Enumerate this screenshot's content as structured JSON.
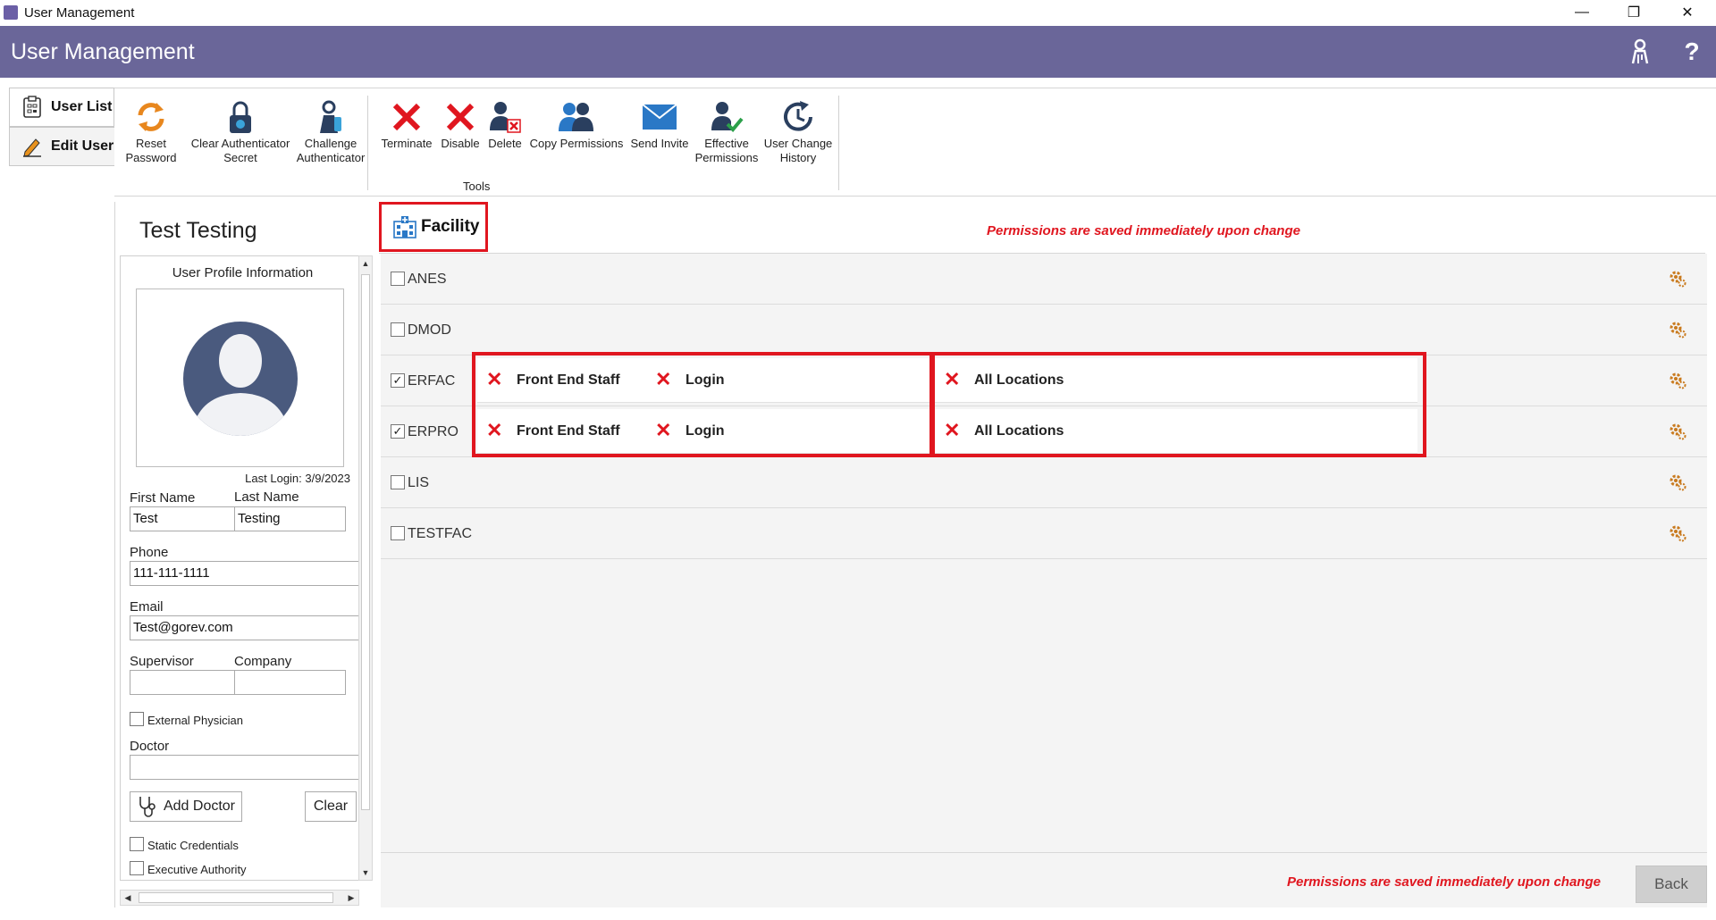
{
  "window": {
    "title": "User Management",
    "controls": [
      "—",
      "❐",
      "✕"
    ]
  },
  "header": {
    "title": "User Management",
    "key_icon": "key-person-icon",
    "help_label": "?"
  },
  "side_tabs": [
    {
      "label": "User List",
      "icon": "clipboard-icon"
    },
    {
      "label": "Edit User",
      "icon": "pencil-icon"
    }
  ],
  "ribbon": {
    "buttons": [
      {
        "label": "Reset\nPassword",
        "icon": "reset-icon"
      },
      {
        "label": "Clear Authenticator\nSecret",
        "icon": "lock-icon"
      },
      {
        "label": "Challenge\nAuthenticator",
        "icon": "key-person-icon"
      },
      {
        "label": "Terminate",
        "icon": "red-x-icon"
      },
      {
        "label": "Disable",
        "icon": "red-x-icon"
      },
      {
        "label": "Delete",
        "icon": "user-delete-icon"
      },
      {
        "label": "Copy Permissions",
        "icon": "users-icon"
      },
      {
        "label": "Send Invite",
        "icon": "envelope-icon"
      },
      {
        "label": "Effective\nPermissions",
        "icon": "user-check-icon"
      },
      {
        "label": "User Change\nHistory",
        "icon": "history-icon"
      }
    ],
    "group_label": "Tools"
  },
  "user": {
    "display_name": "Test Testing",
    "profile_header": "User Profile Information",
    "last_login": "Last Login: 3/9/2023",
    "first_name_label": "First Name",
    "first_name": "Test",
    "last_name_label": "Last Name",
    "last_name": "Testing",
    "phone_label": "Phone",
    "phone": "111-111-1111",
    "email_label": "Email",
    "email": "Test@gorev.com",
    "supervisor_label": "Supervisor",
    "supervisor": "",
    "company_label": "Company",
    "company": "",
    "external_physician_label": "External Physician",
    "doctor_label": "Doctor",
    "doctor": "",
    "add_doctor_label": "Add Doctor",
    "clear_label": "Clear",
    "static_credentials_label": "Static Credentials",
    "executive_authority_label": "Executive Authority"
  },
  "facility": {
    "tab_label": "Facility",
    "save_note": "Permissions are saved immediately upon change",
    "rows": [
      {
        "name": "ANES",
        "checked": false,
        "roles": [],
        "locations": []
      },
      {
        "name": "DMOD",
        "checked": false,
        "roles": [],
        "locations": []
      },
      {
        "name": "ERFAC",
        "checked": true,
        "roles": [
          "Front End Staff",
          "Login"
        ],
        "locations": [
          "All Locations"
        ]
      },
      {
        "name": "ERPRO",
        "checked": true,
        "roles": [
          "Front End Staff",
          "Login"
        ],
        "locations": [
          "All Locations"
        ]
      },
      {
        "name": "LIS",
        "checked": false,
        "roles": [],
        "locations": []
      },
      {
        "name": "TESTFAC",
        "checked": false,
        "roles": [],
        "locations": []
      }
    ],
    "check_mark": "✓",
    "remove_mark": "✕",
    "colors": {
      "accent": "#e0161f",
      "header": "#6a6699",
      "gear": "#c97a1e"
    }
  },
  "footer": {
    "save_note": "Permissions are saved immediately upon change",
    "back_label": "Back"
  }
}
